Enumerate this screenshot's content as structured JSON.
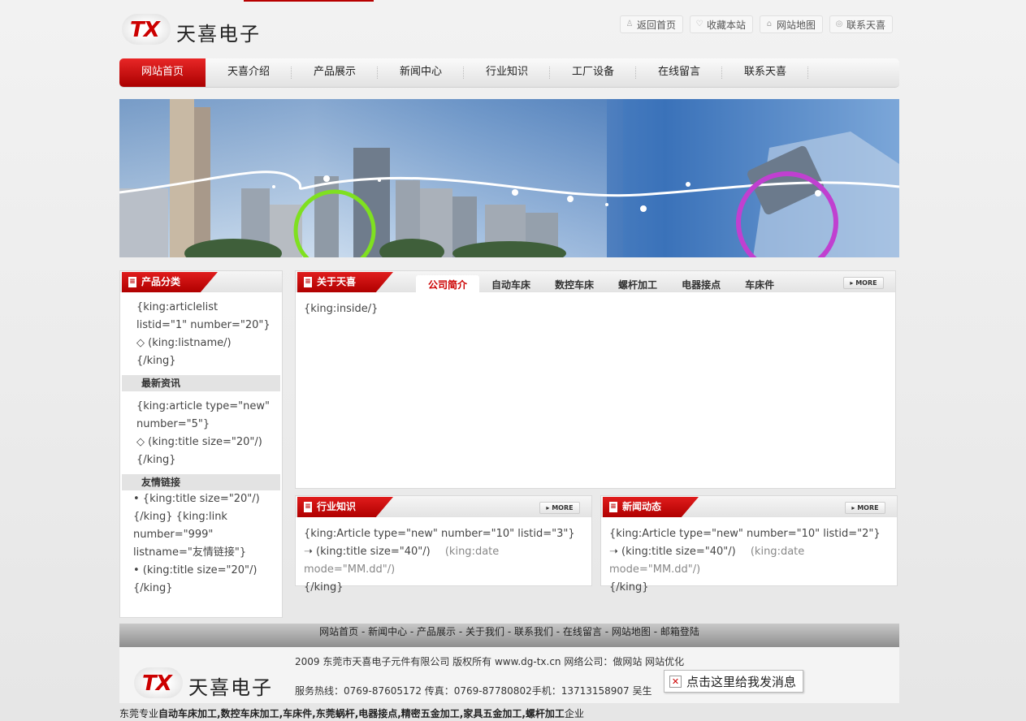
{
  "header": {
    "logo_mark": "TX",
    "logo_text": "天喜电子",
    "links": [
      {
        "label": "返回首页",
        "icon": "user-icon"
      },
      {
        "label": "收藏本站",
        "icon": "favorite-icon"
      },
      {
        "label": "网站地图",
        "icon": "home-icon"
      },
      {
        "label": "联系天喜",
        "icon": "contact-icon"
      }
    ]
  },
  "nav": [
    "网站首页",
    "天喜介绍",
    "产品展示",
    "新闻中心",
    "行业知识",
    "工厂设备",
    "在线留言",
    "联系天喜"
  ],
  "left": {
    "title": "产品分类",
    "product_lines": [
      "{king:articlelist listid=\"1\" number=\"20\"}",
      "◇ (king:listname/)",
      "{/king}"
    ],
    "news_title": "最新资讯",
    "news_lines": [
      "{king:article type=\"new\" number=\"5\"}",
      "◇ (king:title size=\"20\"/)",
      "{/king}"
    ],
    "links_title": "友情链接",
    "links_lines": [
      "• {king:title size=\"20\"/)",
      "{/king} {king:link number=\"999\" listname=\"友情链接\"}",
      "• (king:title size=\"20\"/)",
      "{/king}"
    ]
  },
  "about": {
    "title": "关于天喜",
    "tabs": [
      "公司简介",
      "自动车床",
      "数控车床",
      "螺杆加工",
      "电器接点",
      "车床件"
    ],
    "more": "MORE",
    "body": "{king:inside/}"
  },
  "industry": {
    "title": "行业知识",
    "more": "MORE",
    "line1": "{king:Article type=\"new\" number=\"10\" listid=\"3\"}",
    "item": "(king:title size=\"40\"/)",
    "date": "(king:date mode=\"MM.dd\"/)",
    "end": "{/king}"
  },
  "news": {
    "title": "新闻动态",
    "more": "MORE",
    "line1": "{king:Article type=\"new\" number=\"10\" listid=\"2\"}",
    "item": "(king:title size=\"40\"/)",
    "date": "(king:date mode=\"MM.dd\"/)",
    "end": "{/king}"
  },
  "footer": {
    "nav": "网站首页 - 新闻中心 - 产品展示 - 关于我们 - 联系我们 - 在线留言 - 网站地图 - 邮箱登陆",
    "copyright": "2009 东莞市天喜电子元件有限公司 版权所有 www.dg-tx.cn 网络公司：做网站 网站优化",
    "contact": "服务热线：0769-87605172 传真：0769-87780802手机：13713158907 吴生",
    "message_button": "点击这里给我发消息",
    "seo_prefix": "东莞专业",
    "seo_keywords": "自动车床加工,数控车床加工,车床件,东莞蜗杆,电器接点,精密五金加工,家具五金加工,螺杆加工",
    "seo_suffix": "企业"
  },
  "colors": {
    "brand_red": "#cc0000",
    "nav_active": "#d91515"
  }
}
